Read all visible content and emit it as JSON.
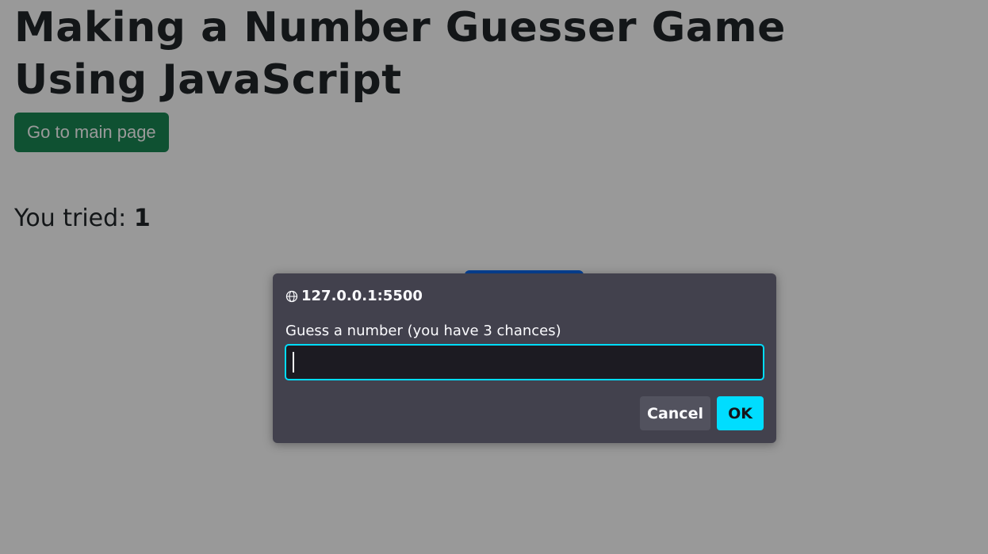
{
  "page": {
    "title": "Making a Number Guesser Game Using JavaScript",
    "main_button_label": "Go to main page",
    "tried_label": "You tried:",
    "tried_count": "1"
  },
  "dialog": {
    "origin": "127.0.0.1:5500",
    "message": "Guess a number (you have 3 chances)",
    "input_value": "",
    "cancel_label": "Cancel",
    "ok_label": "OK",
    "origin_icon": "globe-icon"
  },
  "colors": {
    "primary_button": "#198754",
    "dialog_bg": "#42414d",
    "accent": "#00ddff",
    "overlay": "rgba(0,0,0,0.40)"
  }
}
